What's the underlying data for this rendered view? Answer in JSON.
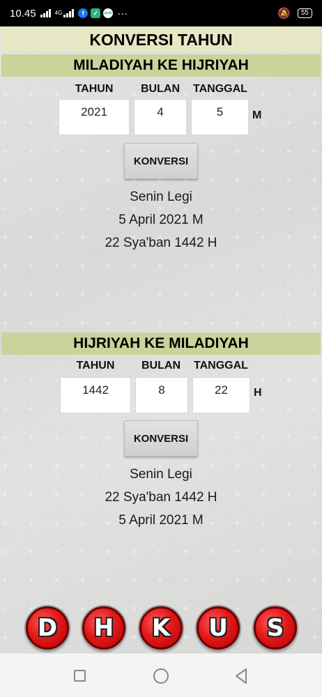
{
  "status_bar": {
    "time": "10.45",
    "network_label": "4G",
    "battery": "55",
    "icons": [
      "signal-icon",
      "signal-icon",
      "facebook-icon",
      "app-icon",
      "grab-icon",
      "more-icon",
      "mute-icon",
      "battery-icon"
    ]
  },
  "app": {
    "title": "KONVERSI TAHUN"
  },
  "section_m2h": {
    "title": "MILADIYAH KE HIJRIYAH",
    "labels": {
      "year": "TAHUN",
      "month": "BULAN",
      "day": "TANGGAL"
    },
    "values": {
      "year": "2021",
      "month": "4",
      "day": "5"
    },
    "unit": "M",
    "button": "KONVERSI",
    "results": [
      "Senin Legi",
      "5 April 2021 M",
      "22 Sya'ban 1442 H"
    ]
  },
  "section_h2m": {
    "title": "HIJRIYAH KE MILADIYAH",
    "labels": {
      "year": "TAHUN",
      "month": "BULAN",
      "day": "TANGGAL"
    },
    "values": {
      "year": "1442",
      "month": "8",
      "day": "22"
    },
    "unit": "H",
    "button": "KONVERSI",
    "results": [
      "Senin Legi",
      "22 Sya'ban 1442 H",
      "5 April 2021 M"
    ]
  },
  "bottom_nav": [
    "D",
    "H",
    "K",
    "U",
    "S"
  ],
  "colors": {
    "title_bg": "#e6e7c4",
    "section_bg": "#c8d499",
    "nav_red": "#e31a1a"
  }
}
